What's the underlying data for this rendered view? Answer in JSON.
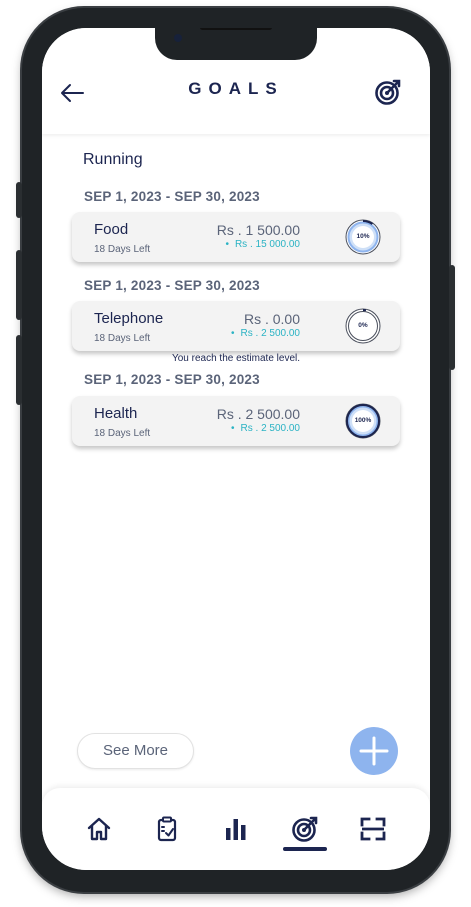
{
  "header": {
    "title": "GOALS",
    "back_icon": "arrow-left-icon",
    "action_icon": "target-icon"
  },
  "section": {
    "title": "Running"
  },
  "goals": [
    {
      "period": "SEP 1, 2023 - SEP 30, 2023",
      "name": "Food",
      "days_left": "18 Days Left",
      "amount": "Rs . 1 500.00",
      "target": "Rs . 15 000.00",
      "percent_label": "10%",
      "progress": 0.1
    },
    {
      "period": "SEP 1, 2023 - SEP 30, 2023",
      "name": "Telephone",
      "days_left": "18 Days Left",
      "amount": "Rs . 0.00",
      "target": "Rs . 2 500.00",
      "percent_label": "0%",
      "progress": 0.0,
      "note": "You reach the estimate level."
    },
    {
      "period": "SEP 1, 2023 - SEP 30, 2023",
      "name": "Health",
      "days_left": "18 Days Left",
      "amount": "Rs . 2 500.00",
      "target": "Rs . 2 500.00",
      "percent_label": "100%",
      "progress": 1.0
    }
  ],
  "footer": {
    "see_more": "See More",
    "add_icon": "plus-icon"
  },
  "tabs": [
    {
      "name": "home",
      "icon": "home-icon"
    },
    {
      "name": "tasks",
      "icon": "clipboard-check-icon"
    },
    {
      "name": "reports",
      "icon": "bar-chart-icon"
    },
    {
      "name": "goals",
      "icon": "target-icon",
      "active": true
    },
    {
      "name": "scan",
      "icon": "scan-icon"
    }
  ],
  "colors": {
    "primary": "#1c2550",
    "accent": "#2bb3c4",
    "fab": "#8eb4ee",
    "ring_fill": "#cfe0f7"
  }
}
